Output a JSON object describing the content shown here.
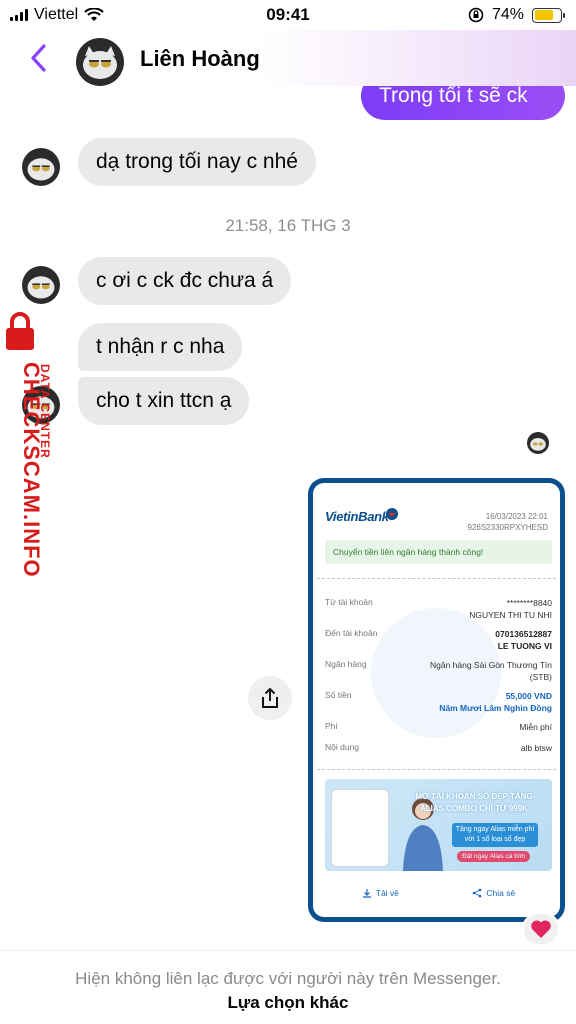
{
  "status_bar": {
    "carrier": "Viettel",
    "time": "09:41",
    "battery_percent": "74%",
    "battery_level": 0.74,
    "battery_color": "#f5c400"
  },
  "header": {
    "contact_name": "Liên Hoàng",
    "back_icon": "chevron-left-icon",
    "accent_color": "#8a3ffc"
  },
  "messages": {
    "out_partial": "Trong tối t sẽ ck",
    "in_1": "dạ trong tối nay c nhé",
    "timestamp": "21:58, 16 THG 3",
    "in_2": "c ơi c ck đc chưa á",
    "in_3": "t nhận r c nha",
    "in_4": "cho t xin ttcn ạ"
  },
  "receipt": {
    "bank_logo": "VietinBank",
    "datetime": "16/03/2023 22:01",
    "ref_code": "926S2330RPXYHESD",
    "success_text": "Chuyển tiền liên ngân hàng thành công!",
    "rows": [
      {
        "label": "Từ tài khoản",
        "value": "********8840",
        "value2": "NGUYEN THI TU NHI"
      },
      {
        "label": "Đến tài khoản",
        "value": "070136512887",
        "value2": "LE TUONG VI"
      },
      {
        "label": "Ngân hàng",
        "value": "Ngân hàng Sài Gòn Thương Tín",
        "value2": "(STB)"
      },
      {
        "label": "Số tiền",
        "value": "55,000 VND",
        "value2": "Năm Mươi Lăm Nghìn Đồng"
      },
      {
        "label": "Phí",
        "value": "Miễn phí",
        "value2": ""
      },
      {
        "label": "Nội dung",
        "value": "alb btsw",
        "value2": ""
      }
    ],
    "promo": {
      "title": "MỞ TÀI KHOẢN SỐ ĐẸP TẶNG ALIAS COMBO CHỈ TỪ 999K",
      "sub": "Tặng ngay Alias miễn phí với 1 số loại số đẹp",
      "cta": "Đặt ngay Alias cá tính"
    },
    "download_label": "Tải về",
    "share_label": "Chia sẻ"
  },
  "watermark": {
    "line1": "CHECKSCAM.INFO",
    "line2": "DATA CENTER"
  },
  "reaction": "❤️",
  "footer": {
    "note": "Hiện không liên lạc được với người này trên Messenger.",
    "link": "Lựa chọn khác"
  }
}
